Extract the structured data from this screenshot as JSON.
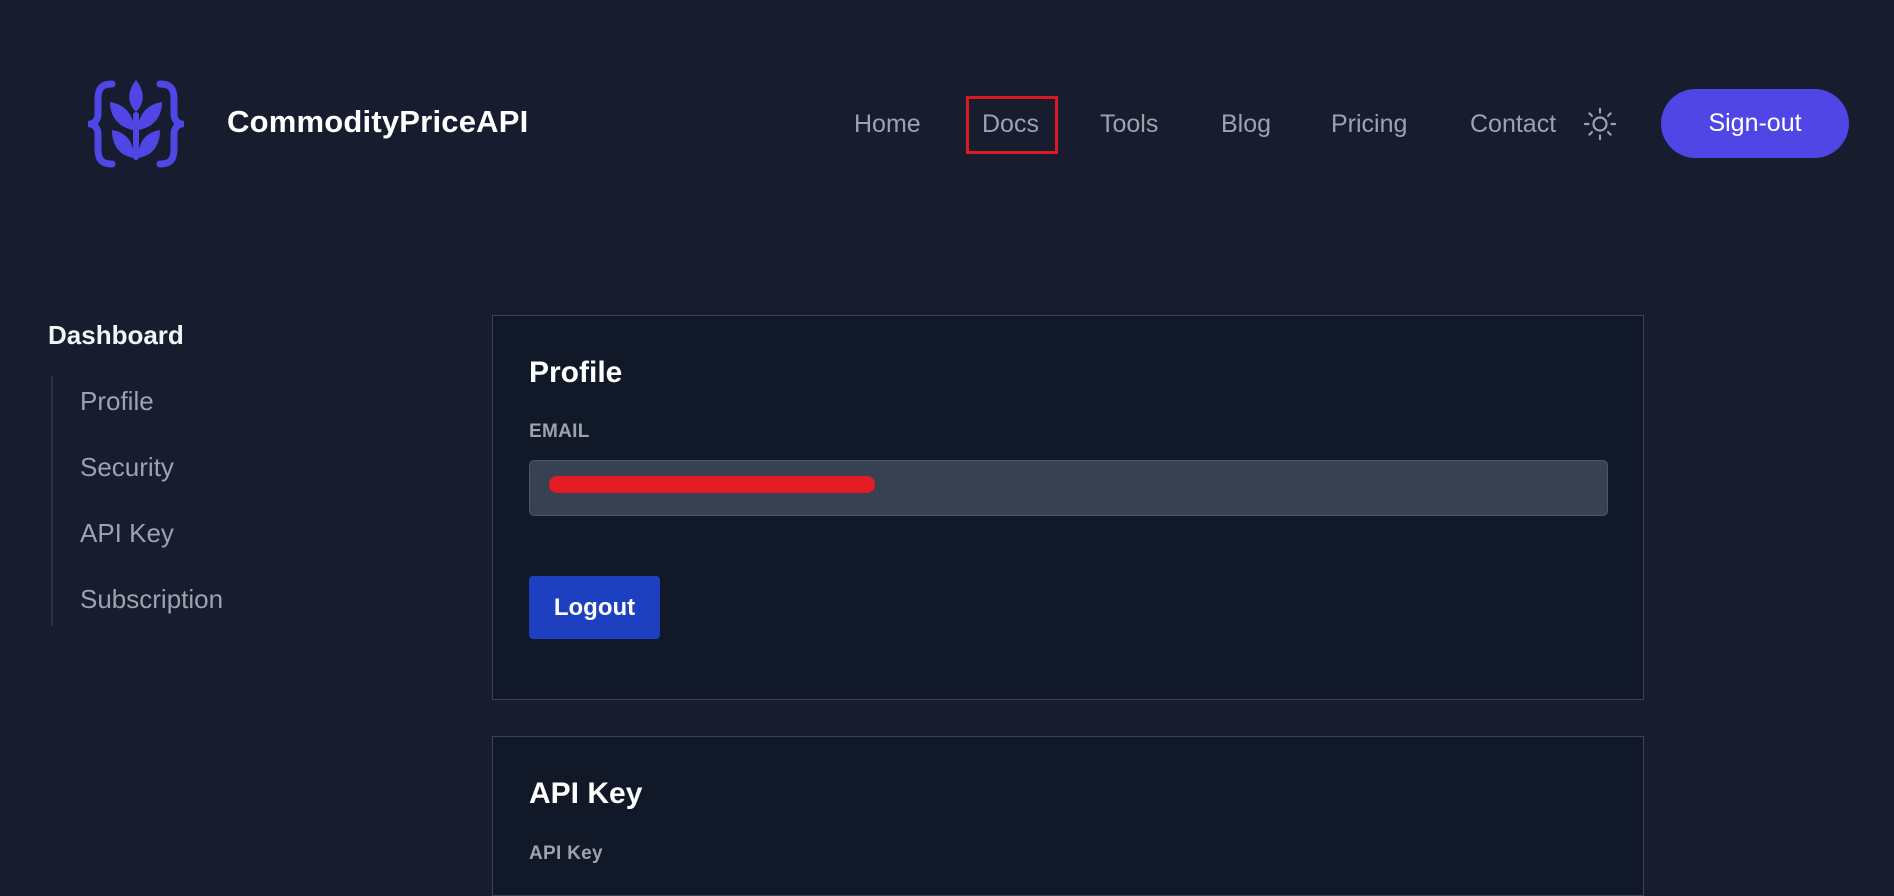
{
  "brand": {
    "name": "CommodityPriceAPI",
    "accent_color": "#4f46e5",
    "logo_icon": "wheat-braces-icon"
  },
  "nav": {
    "items": [
      {
        "label": "Home"
      },
      {
        "label": "Docs",
        "highlighted": true
      },
      {
        "label": "Tools"
      },
      {
        "label": "Blog"
      },
      {
        "label": "Pricing"
      },
      {
        "label": "Contact"
      }
    ],
    "theme_toggle_icon": "sun-icon",
    "signout_label": "Sign-out"
  },
  "sidebar": {
    "title": "Dashboard",
    "items": [
      {
        "label": "Profile"
      },
      {
        "label": "Security"
      },
      {
        "label": "API Key"
      },
      {
        "label": "Subscription"
      }
    ]
  },
  "profile_card": {
    "title": "Profile",
    "email_label": "EMAIL",
    "email_value": "",
    "logout_label": "Logout"
  },
  "apikey_card": {
    "title": "API Key",
    "field_label": "API Key"
  }
}
